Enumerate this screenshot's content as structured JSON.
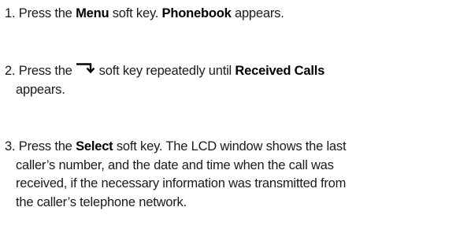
{
  "steps": [
    {
      "number": "1.",
      "text_a": "Press the",
      "key": "Menu",
      "text_b": "soft key.",
      "result": "Phonebook",
      "text_c": "appears."
    },
    {
      "number": "2.",
      "text_a": "Press the",
      "icon": "down-right-arrow-icon",
      "text_b": "soft key repeatedly until",
      "result": "Received Calls",
      "text_c": "appears."
    },
    {
      "number": "3.",
      "text_a": "Press the",
      "key": "Select",
      "text_b": "soft key. The LCD window shows the last",
      "line2": "caller’s number, and the date and time when the call was",
      "line3": "received, if the necessary information was transmitted from",
      "line4": "the caller’s telephone network."
    }
  ]
}
